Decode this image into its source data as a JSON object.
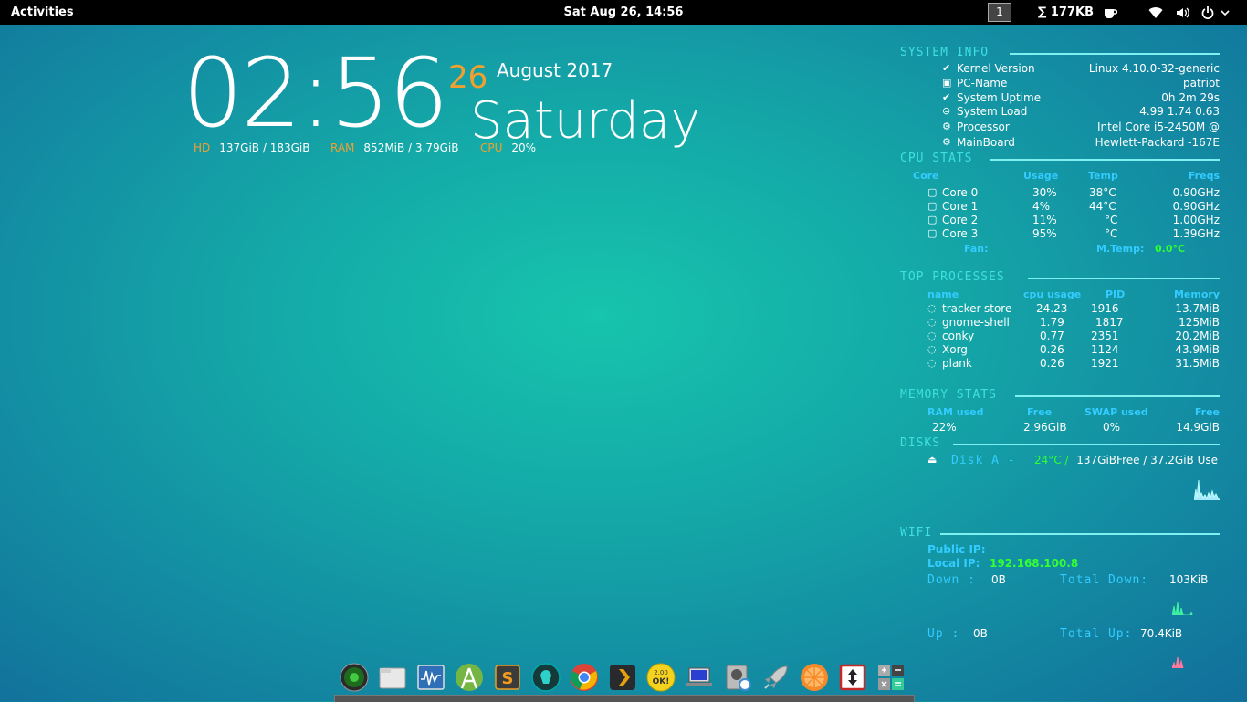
{
  "topbar": {
    "activities": "Activities",
    "datetime": "Sat Aug 26, 14:56",
    "workspace": "1",
    "net_speed": "∑ 177KB",
    "icons": [
      "coffee-icon",
      "wifi-icon",
      "volume-icon",
      "power-icon",
      "chevron-down-icon"
    ]
  },
  "clock": {
    "time": "02:56",
    "day": "26",
    "month_year": "August 2017",
    "weekday": "Saturday",
    "hd_label": "HD",
    "hd_value": "137GiB / 183GiB",
    "ram_label": "RAM",
    "ram_value": "852MiB / 3.79GiB",
    "cpu_label": "CPU",
    "cpu_value": "20%"
  },
  "system_info": {
    "title": "SYSTEM INFO",
    "rows": [
      {
        "label": "Kernel Version",
        "value": "Linux 4.10.0-32-generic"
      },
      {
        "label": "PC-Name",
        "value": "patriot"
      },
      {
        "label": "System Uptime",
        "value": "0h 2m 29s"
      },
      {
        "label": "System Load",
        "value": "4.99 1.74 0.63"
      },
      {
        "label": "Processor",
        "value": "Intel Core i5-2450M @"
      },
      {
        "label": "MainBoard",
        "value": "Hewlett-Packard -167E"
      }
    ]
  },
  "cpu_stats": {
    "title": "CPU STATS",
    "headers": {
      "core": "Core",
      "usage": "Usage",
      "temp": "Temp",
      "freq": "Freqs"
    },
    "cores": [
      {
        "name": "Core 0",
        "usage": "30%",
        "temp": "38°C",
        "freq": "0.90GHz"
      },
      {
        "name": "Core 1",
        "usage": "4%",
        "temp": "44°C",
        "freq": "0.90GHz"
      },
      {
        "name": "Core 2",
        "usage": "11%",
        "temp": "°C",
        "freq": "1.00GHz"
      },
      {
        "name": "Core 3",
        "usage": "95%",
        "temp": "°C",
        "freq": "1.39GHz"
      }
    ],
    "fan_label": "Fan:",
    "mtemp_label": "M.Temp:",
    "mtemp_value": "0.0°C"
  },
  "top_processes": {
    "title": "TOP PROCESSES",
    "headers": {
      "name": "name",
      "cpu": "cpu usage",
      "pid": "PID",
      "mem": "Memory"
    },
    "rows": [
      {
        "name": "tracker-store",
        "cpu": "24.23",
        "pid": "1916",
        "mem": "13.7MiB"
      },
      {
        "name": "gnome-shell",
        "cpu": "1.79",
        "pid": "1817",
        "mem": "125MiB"
      },
      {
        "name": "conky",
        "cpu": "0.77",
        "pid": "2351",
        "mem": "20.2MiB"
      },
      {
        "name": "Xorg",
        "cpu": "0.26",
        "pid": "1124",
        "mem": "43.9MiB"
      },
      {
        "name": "plank",
        "cpu": "0.26",
        "pid": "1921",
        "mem": "31.5MiB"
      }
    ]
  },
  "memory_stats": {
    "title": "MEMORY STATS",
    "headers": {
      "ram_used": "RAM used",
      "free": "Free",
      "swap_used": "SWAP used",
      "swap_free": "Free"
    },
    "values": {
      "ram_used": "22%",
      "free": "2.96GiB",
      "swap_used": "0%",
      "swap_free": "14.9GiB"
    }
  },
  "disks": {
    "title": "DISKS",
    "name": "Disk A -",
    "temp": "24°C /",
    "usage": "137GiBFree / 37.2GiB Use"
  },
  "wifi": {
    "title": "WIFI",
    "public_ip_label": "Public IP:",
    "local_ip_label": "Local IP:",
    "local_ip_value": "192.168.100.8",
    "down_label": "Down :",
    "down_value": "0B",
    "total_down_label": "Total Down:",
    "total_down_value": "103KiB",
    "up_label": "Up :",
    "up_value": "0B",
    "total_up_label": "Total Up:",
    "total_up_value": "70.4KiB"
  },
  "dock": {
    "apps": [
      "radar-icon",
      "files-icon",
      "system-monitor-icon",
      "android-studio-icon",
      "sublime-text-icon",
      "gitkraken-icon",
      "chrome-icon",
      "plex-icon",
      "checkbox-ok-icon",
      "remote-desktop-icon",
      "disk-usage-icon",
      "rocket-icon",
      "orange-slice-icon",
      "transfer-icon",
      "calculator-icon"
    ]
  },
  "colors": {
    "accent_orange": "#f0a030",
    "conky_cyan": "#33ccff",
    "graph_teal": "#7ff0f0",
    "green": "#33ff33"
  }
}
